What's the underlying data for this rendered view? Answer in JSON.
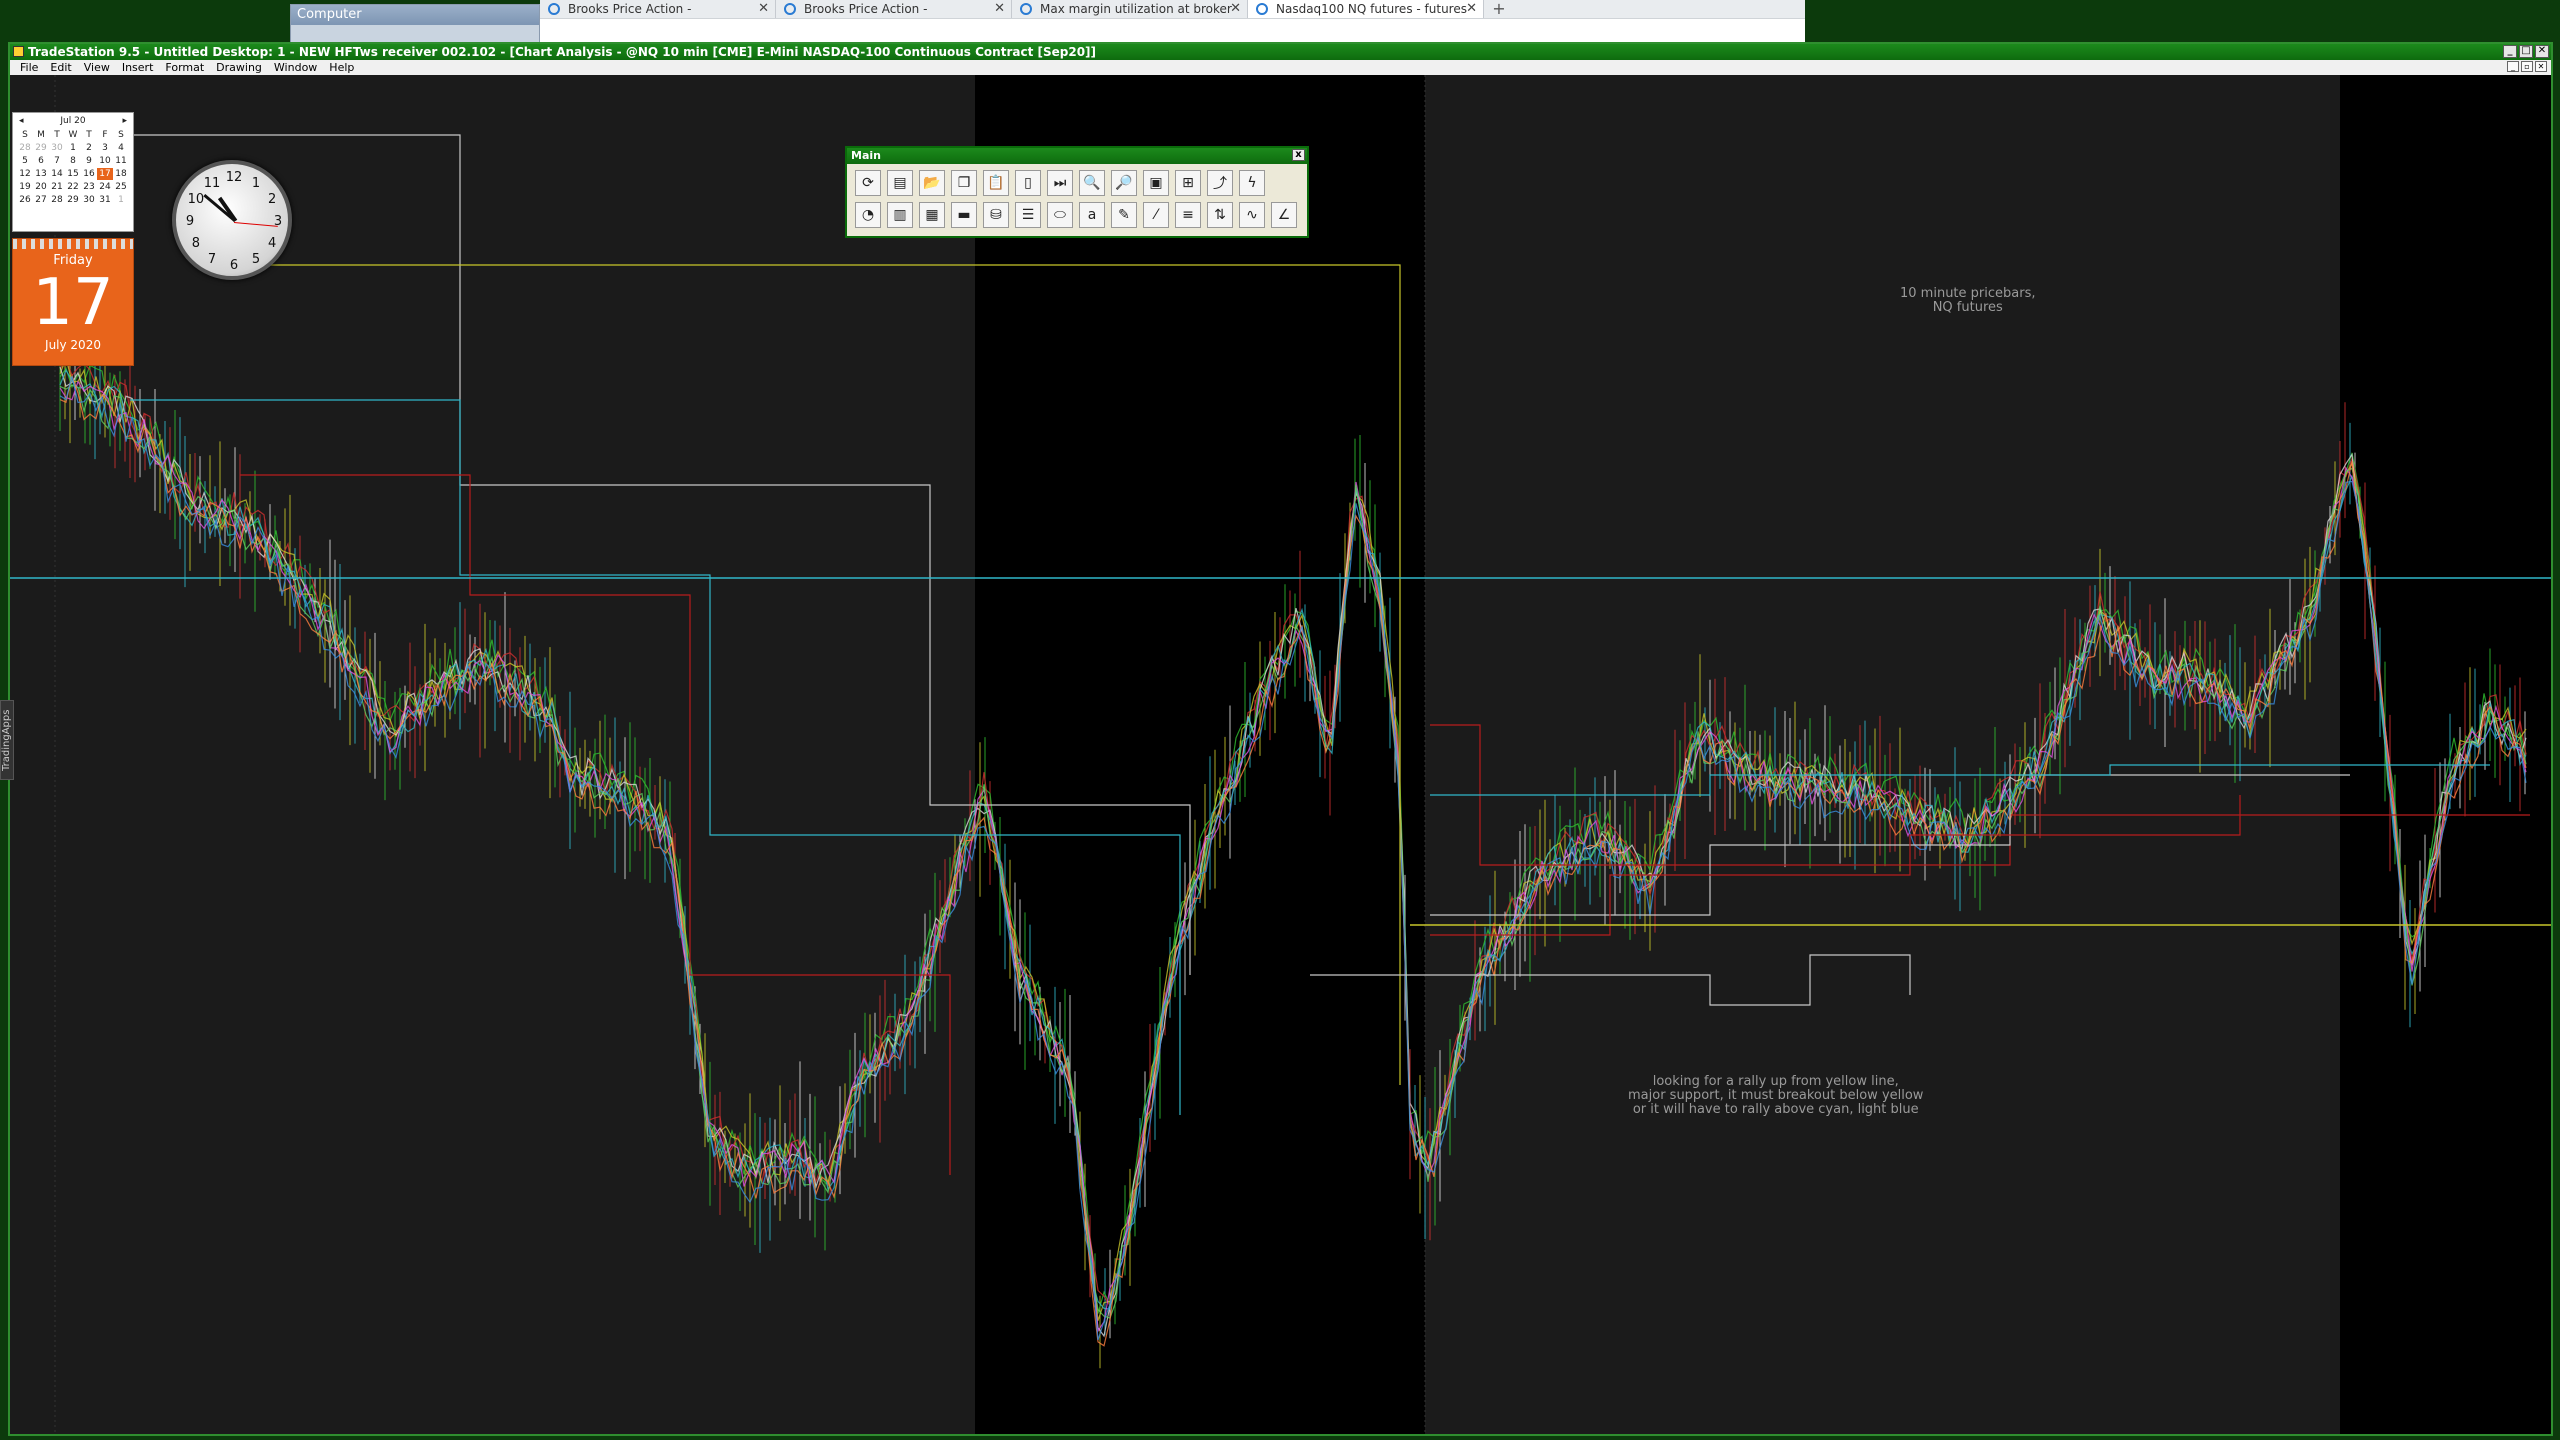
{
  "explorer": {
    "title": "Computer"
  },
  "browser": {
    "tabs": [
      {
        "label": "Brooks Price Action -",
        "active": false
      },
      {
        "label": "Brooks Price Action -",
        "active": false
      },
      {
        "label": "Max margin utilization at broker",
        "active": false
      },
      {
        "label": "Nasdaq100 NQ futures - futures",
        "active": true
      }
    ],
    "new_tab_symbol": "+"
  },
  "window": {
    "title": "TradeStation 9.5 - Untitled Desktop: 1 - NEW HFTws receiver 002.102 - [Chart Analysis - @NQ 10 min [CME] E-Mini NASDAQ-100 Continuous Contract [Sep20]]"
  },
  "menu": [
    "File",
    "Edit",
    "View",
    "Insert",
    "Format",
    "Drawing",
    "Window",
    "Help"
  ],
  "toolbar": {
    "title": "Main",
    "close": "x"
  },
  "side_tab": "TradingApps",
  "calendar": {
    "month": "Jul 20",
    "prev": "◂",
    "next": "▸",
    "weekdays": [
      "S",
      "M",
      "T",
      "W",
      "T",
      "F",
      "S"
    ],
    "days": [
      "28",
      "29",
      "30",
      "1",
      "2",
      "3",
      "4",
      "5",
      "6",
      "7",
      "8",
      "9",
      "10",
      "11",
      "12",
      "13",
      "14",
      "15",
      "16",
      "17",
      "18",
      "19",
      "20",
      "21",
      "22",
      "23",
      "24",
      "25",
      "26",
      "27",
      "28",
      "29",
      "30",
      "31",
      "1"
    ],
    "today": "17",
    "card_weekday": "Friday",
    "card_day": "17",
    "card_month": "July 2020"
  },
  "clock": {
    "numerals": [
      "12",
      "1",
      "2",
      "3",
      "4",
      "5",
      "6",
      "7",
      "8",
      "9",
      "10",
      "11"
    ]
  },
  "chart": {
    "note_top": "10 minute pricebars,\nNQ futures",
    "note_bottom": "looking for a rally up from yellow line,\nmajor support, it must breakout below yellow\nor it will have to rally above cyan, light blue",
    "colors": {
      "background": "#1b1b1b",
      "session_black": "#000000",
      "cyan": "#31b7c9",
      "yellow": "#c8c62a",
      "red": "#b81c1c",
      "white": "#c8c8c8",
      "green": "#2fbf2f"
    }
  }
}
